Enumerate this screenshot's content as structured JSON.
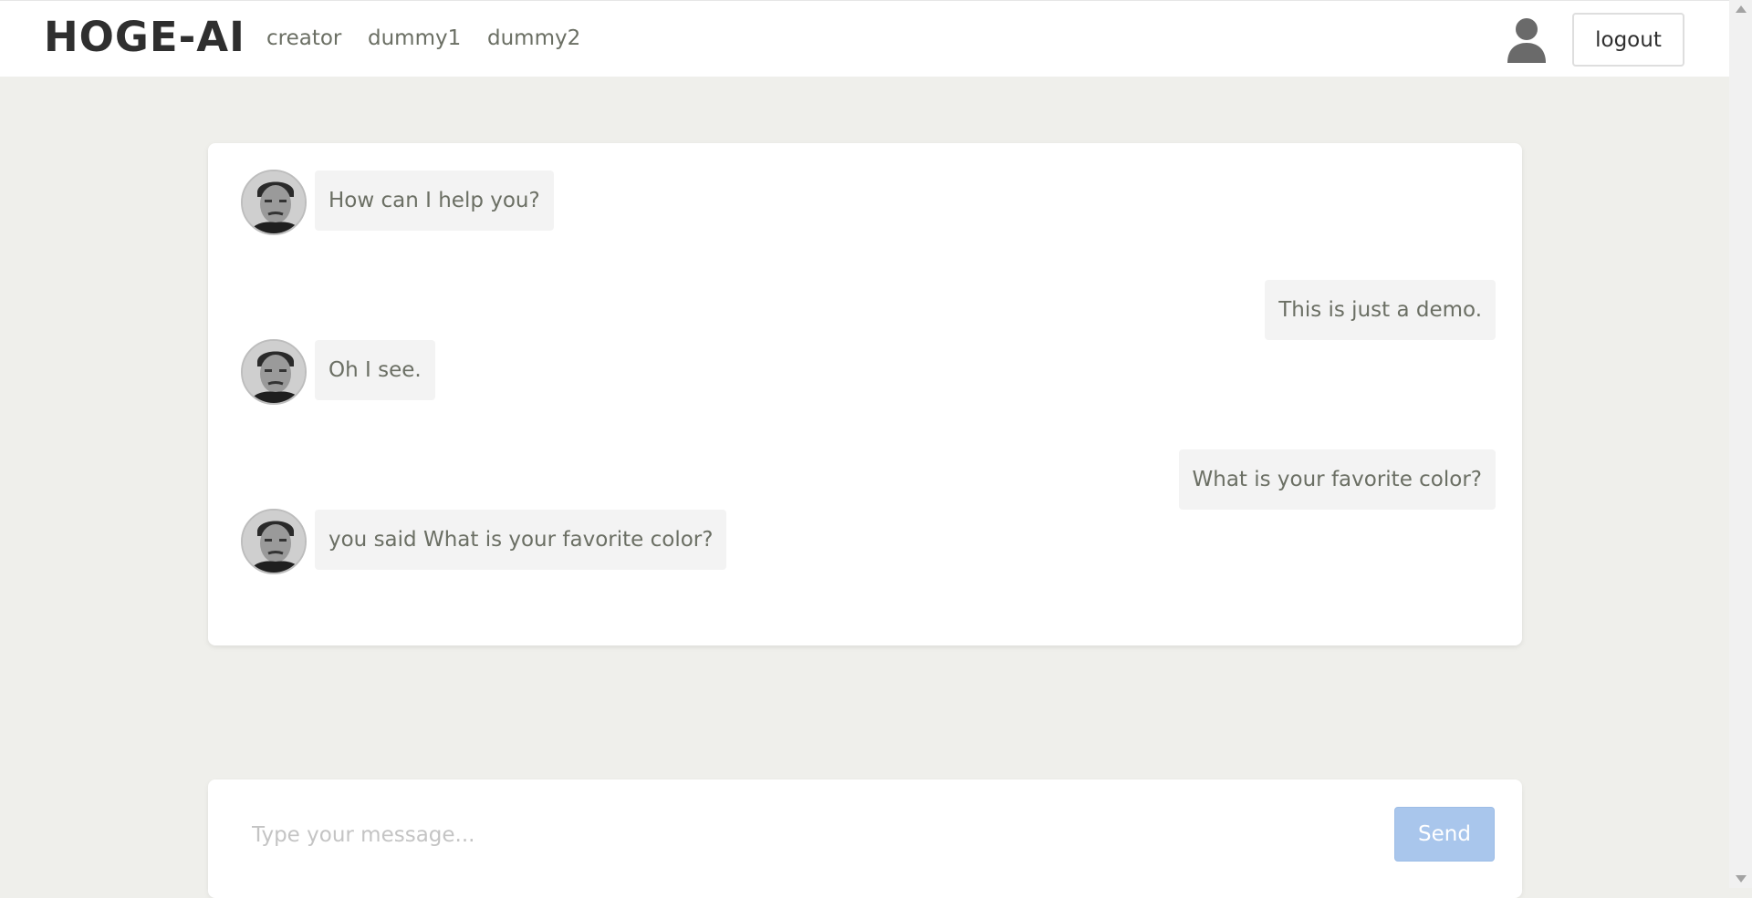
{
  "header": {
    "brand": "HOGE-AI",
    "nav": [
      {
        "label": "creator"
      },
      {
        "label": "dummy1"
      },
      {
        "label": "dummy2"
      }
    ],
    "user_icon": "user-silhouette-icon",
    "logout_label": "logout"
  },
  "chat": {
    "messages": [
      {
        "sender": "bot",
        "text": "How can I help you?"
      },
      {
        "sender": "user",
        "text": "This is just a demo."
      },
      {
        "sender": "bot",
        "text": "Oh I see."
      },
      {
        "sender": "user",
        "text": "What is your favorite color?"
      },
      {
        "sender": "bot",
        "text": "you said What is your favorite color?"
      }
    ]
  },
  "composer": {
    "placeholder": "Type your message...",
    "send_label": "Send"
  },
  "colors": {
    "background": "#efefeb",
    "send_button": "#a9c6ec",
    "bubble": "#f3f3f3",
    "text": "#6b6f64"
  }
}
